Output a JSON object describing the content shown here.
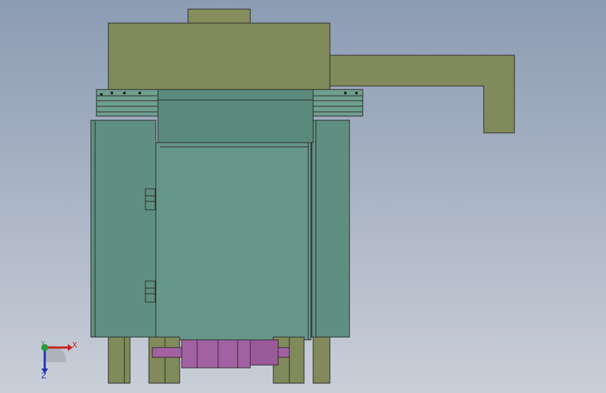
{
  "window": {
    "title": ""
  },
  "triad": {
    "x_label": "X",
    "y_label": "Y",
    "z_label": "Z"
  },
  "colors": {
    "background_top": "#8c9cb3",
    "background_bottom": "#c9cfd8",
    "olive_part": "#808a5a",
    "teal_body": "#5f8f80",
    "teal_dark": "#4f7f71",
    "rail": "#6f9f8f",
    "motor": "#a262a2",
    "edge": "#2a2a2a"
  }
}
